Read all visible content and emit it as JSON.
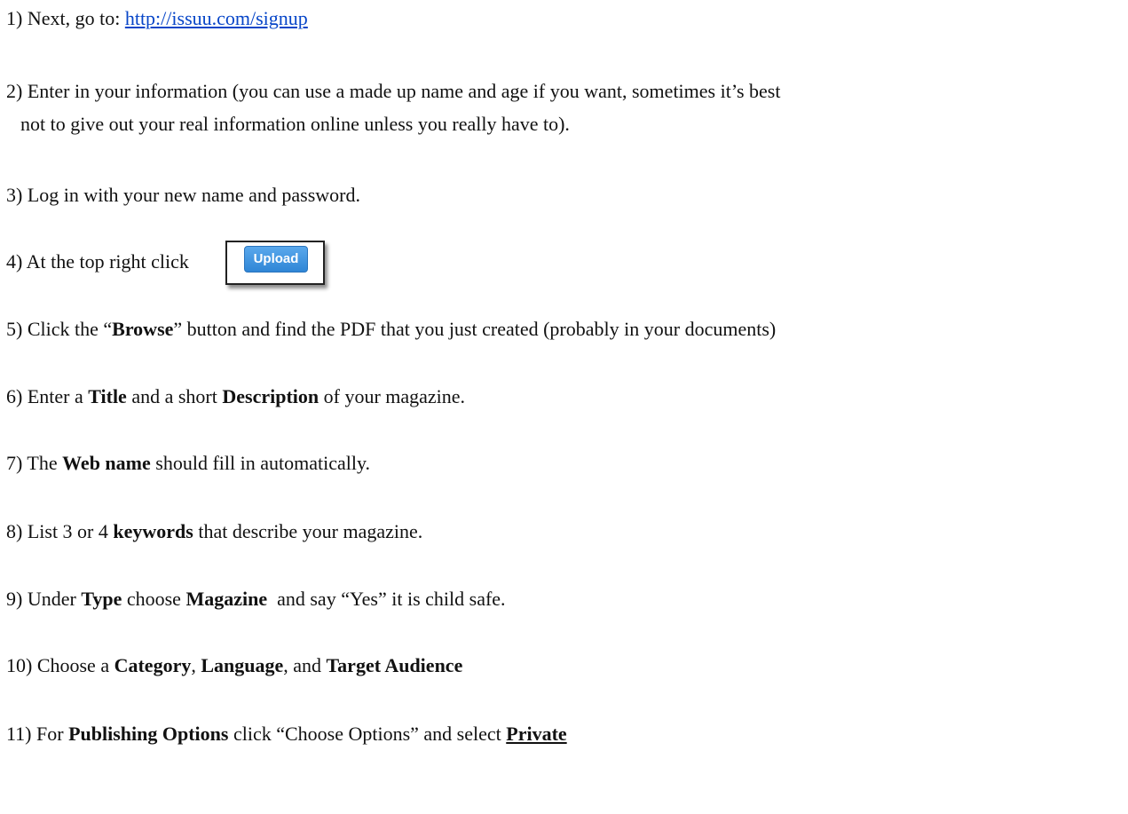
{
  "steps": {
    "s1": {
      "prefix": "1) Next, go to: ",
      "link": "http://issuu.com/signup"
    },
    "s2": {
      "line1": "2) Enter in your information (you can use a made up name and age if you want, sometimes it’s best",
      "line2": "not to give out your real information online unless you really have to)."
    },
    "s3": {
      "text": "3) Log in with your new name and password."
    },
    "s4": {
      "text": "4) At the top right click",
      "button": "Upload"
    },
    "s5": {
      "a": "5) Click the “",
      "b1": "Browse",
      "c": "” button and find the PDF that you just created (probably in your documents)"
    },
    "s6": {
      "a": "6) Enter a ",
      "b1": "Title",
      "c": " and a short ",
      "b2": "Description",
      "d": " of your magazine."
    },
    "s7": {
      "a": "7) The ",
      "b1": "Web name",
      "c": " should fill in automatically."
    },
    "s8": {
      "a": "8) List 3 or 4 ",
      "b1": "keywords",
      "c": " that describe your magazine."
    },
    "s9": {
      "a": "9) Under ",
      "b1": "Type",
      "c": " choose ",
      "b2": "Magazine",
      "d": "  and say “Yes” it is child safe."
    },
    "s10": {
      "a": "10) Choose a ",
      "b1": "Category",
      "c": ", ",
      "b2": "Language",
      "d": ", and ",
      "b3": "Target Audience"
    },
    "s11": {
      "a": "11) For ",
      "b1": "Publishing Options",
      "c": " click “Choose Options” and select ",
      "b2": "Private"
    }
  }
}
